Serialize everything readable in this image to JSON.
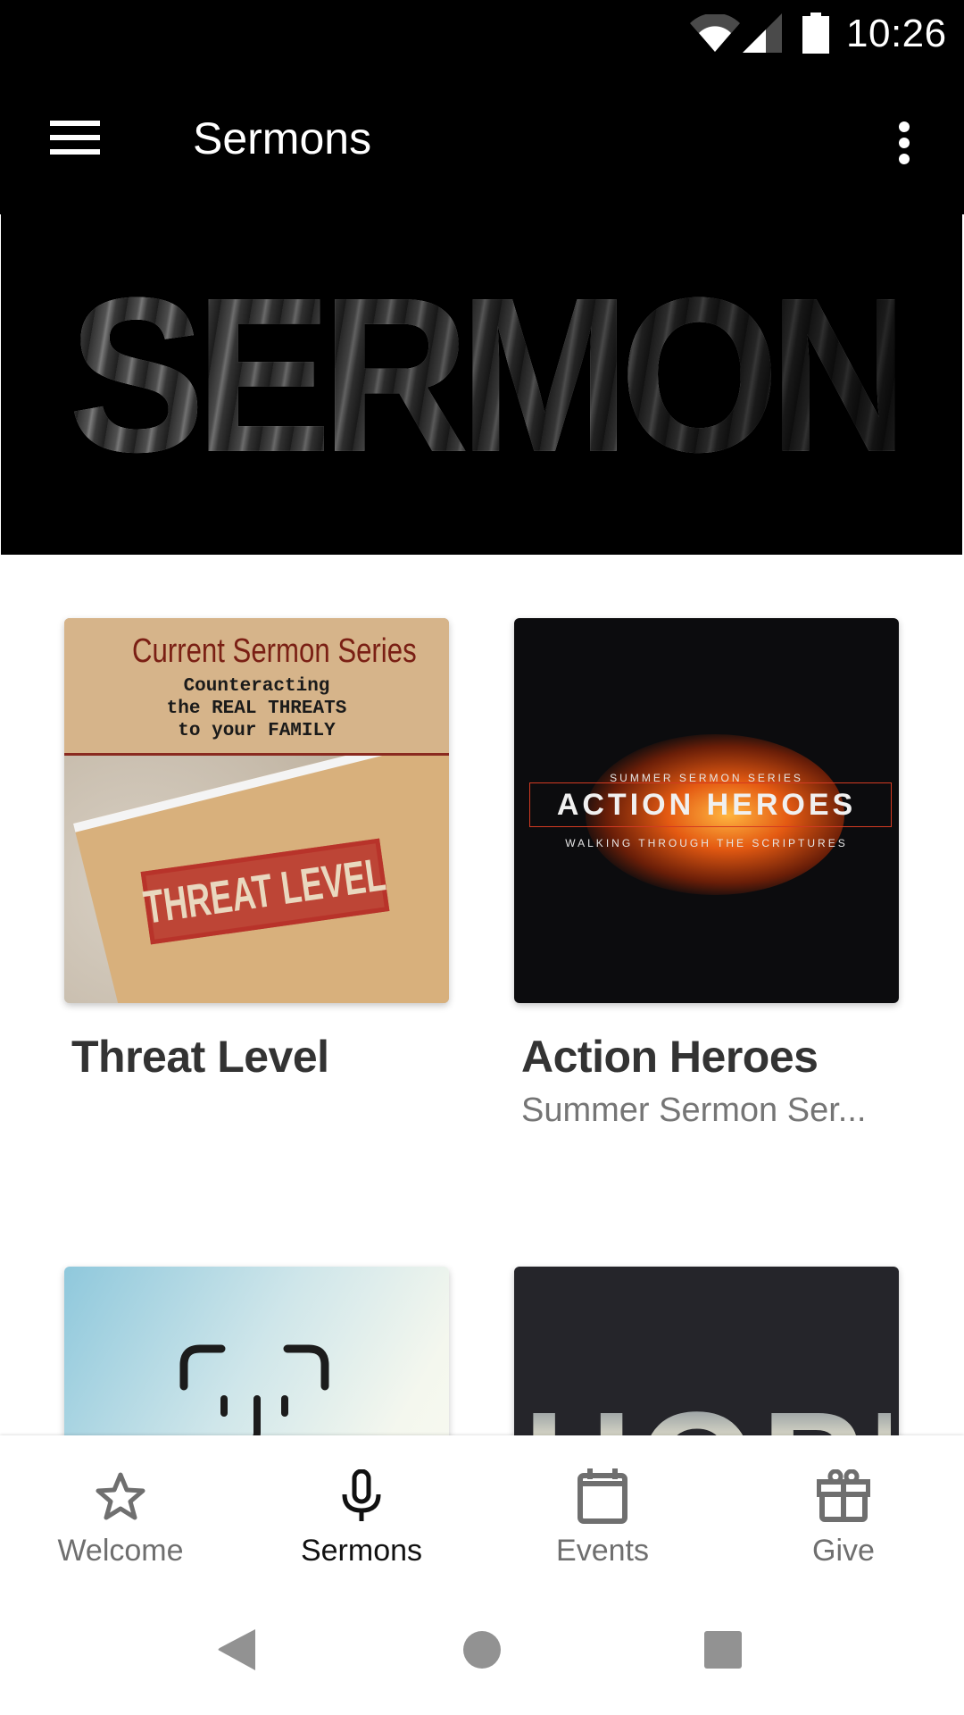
{
  "status_bar": {
    "time": "10:26",
    "icons": [
      "wifi-icon",
      "cellular-signal-icon",
      "battery-icon"
    ]
  },
  "app_bar": {
    "title": "Sermons",
    "menu_icon": "hamburger-menu-icon",
    "overflow_icon": "more-vert-icon"
  },
  "banner": {
    "text": "SERMONS"
  },
  "series": [
    {
      "title": "Threat Level",
      "subtitle": "",
      "art": {
        "heading": "Current Sermon Series",
        "tagline_lines": [
          "Counteracting",
          "the REAL THREATS",
          "to your FAMILY"
        ],
        "stamp": "THREAT LEVEL"
      }
    },
    {
      "title": "Action Heroes",
      "subtitle": "Summer Sermon Ser...",
      "art": {
        "kicker": "SUMMER SERMON SERIES",
        "headline": "ACTION HEROES",
        "tagline": "WALKING THROUGH THE SCRIPTURES"
      }
    },
    {
      "title": "",
      "subtitle": "",
      "art": {}
    },
    {
      "title": "",
      "subtitle": "",
      "art": {
        "headline": "HOPE"
      }
    }
  ],
  "bottom_nav": {
    "active": "Sermons",
    "items": [
      {
        "label": "Welcome",
        "icon": "star-icon"
      },
      {
        "label": "Sermons",
        "icon": "microphone-icon"
      },
      {
        "label": "Events",
        "icon": "calendar-icon"
      },
      {
        "label": "Give",
        "icon": "gift-icon"
      }
    ]
  },
  "system_nav": {
    "buttons": [
      "back",
      "home",
      "recents"
    ]
  },
  "colors": {
    "app_bar_bg": "#000000",
    "active_nav": "#111111",
    "inactive_nav": "#6f6f6f",
    "card_title": "#333333",
    "card_subtitle": "#757575"
  }
}
